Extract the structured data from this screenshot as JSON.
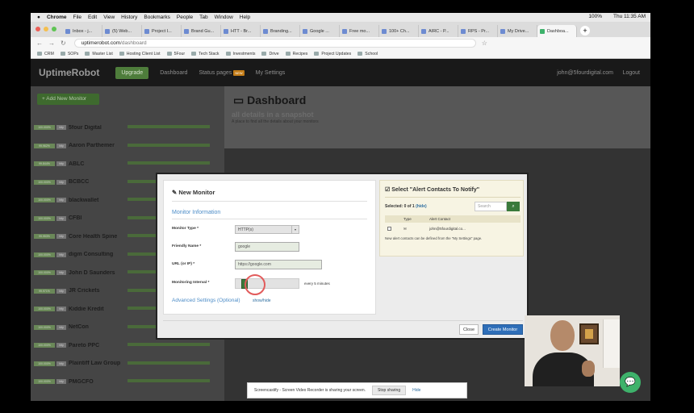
{
  "mac_menu": [
    "Chrome",
    "File",
    "Edit",
    "View",
    "History",
    "Bookmarks",
    "People",
    "Tab",
    "Window",
    "Help"
  ],
  "mac_status": {
    "battery": "100%",
    "clock": "Thu 11:35 AM"
  },
  "tabs": [
    {
      "label": "Inbox - j..."
    },
    {
      "label": "(5) Web..."
    },
    {
      "label": "Project I..."
    },
    {
      "label": "Brand Gu..."
    },
    {
      "label": "HTT - Br..."
    },
    {
      "label": "Branding..."
    },
    {
      "label": "Google ..."
    },
    {
      "label": "Free mo..."
    },
    {
      "label": "100+ Ch..."
    },
    {
      "label": "AIRC - P..."
    },
    {
      "label": "RPS - Pr..."
    },
    {
      "label": "My Drive..."
    },
    {
      "label": "Dashboa..."
    }
  ],
  "address": {
    "host": "uptimerobot.com",
    "path": "/dashboard"
  },
  "bookmarks": [
    "CRM",
    "SOPs",
    "Master List",
    "Hosting Client List",
    "5Four",
    "Tech Stack",
    "Investments",
    "Drive",
    "Recipes",
    "Project Updates",
    "School"
  ],
  "app": {
    "logo": "UptimeRobot",
    "upgrade": "Upgrade",
    "nav": {
      "dashboard": "Dashboard",
      "status_pages": "Status pages",
      "new_badge": "NEW",
      "settings": "My Settings"
    },
    "user_email": "john@5fourdigital.com",
    "logout": "Logout",
    "add_monitor": "+ Add New Monitor",
    "dashboard_title": "Dashboard",
    "dashboard_sub": "all details in a snapshot",
    "dashboard_small": "A place to find all the details about your monitors"
  },
  "monitors": [
    {
      "pct": "100.000%",
      "type": "http",
      "name": "5four Digital"
    },
    {
      "pct": "99.962%",
      "type": "http",
      "name": "Aaron Parthemer"
    },
    {
      "pct": "99.844%",
      "type": "http",
      "name": "ABLC"
    },
    {
      "pct": "100.000%",
      "type": "http",
      "name": "BCBCC"
    },
    {
      "pct": "100.000%",
      "type": "http",
      "name": "blackwallet"
    },
    {
      "pct": "100.000%",
      "type": "http",
      "name": "CFBI"
    },
    {
      "pct": "99.953%",
      "type": "http",
      "name": "Core Health Spine"
    },
    {
      "pct": "100.000%",
      "type": "http",
      "name": "digm Consulting"
    },
    {
      "pct": "100.000%",
      "type": "http",
      "name": "John D Saunders"
    },
    {
      "pct": "99.971%",
      "type": "http",
      "name": "JR Crickets"
    },
    {
      "pct": "100.000%",
      "type": "http",
      "name": "Kiddie Kredit"
    },
    {
      "pct": "100.000%",
      "type": "http",
      "name": "NetCon"
    },
    {
      "pct": "100.000%",
      "type": "http",
      "name": "Pareto PPC"
    },
    {
      "pct": "100.000%",
      "type": "http",
      "name": "Plaintiff Law Group"
    },
    {
      "pct": "100.000%",
      "type": "http",
      "name": "PMGCFO"
    }
  ],
  "modal": {
    "title": "New Monitor",
    "section": "Monitor Information",
    "monitor_type_label": "Monitor Type *",
    "monitor_type_value": "HTTP(s)",
    "friendly_name_label": "Friendly Name *",
    "friendly_name_value": "google",
    "url_label": "URL (or IP) *",
    "url_value": "https://google.com",
    "interval_label": "Monitoring Interval *",
    "interval_text": "every 5 minutes",
    "interval_level": 0.1,
    "advanced": "Advanced Settings (Optional)",
    "show_hide": "show/hide",
    "close": "Close",
    "create": "Create Monitor"
  },
  "alert_contacts": {
    "title": "Select \"Alert Contacts To Notify\"",
    "selected": "Selected: 0 of 1",
    "hide": "(hide)",
    "search_placeholder": "Search",
    "col_type": "Type",
    "col_contact": "Alert Contact",
    "contact": "john@5fourdigital.co...",
    "note": "New alert contacts can be defined from the \"My Settings\" page."
  },
  "screen_share": {
    "text": "Screencastify - Screen Video Recorder is sharing your screen.",
    "stop": "Stop sharing",
    "hide": "Hide"
  }
}
